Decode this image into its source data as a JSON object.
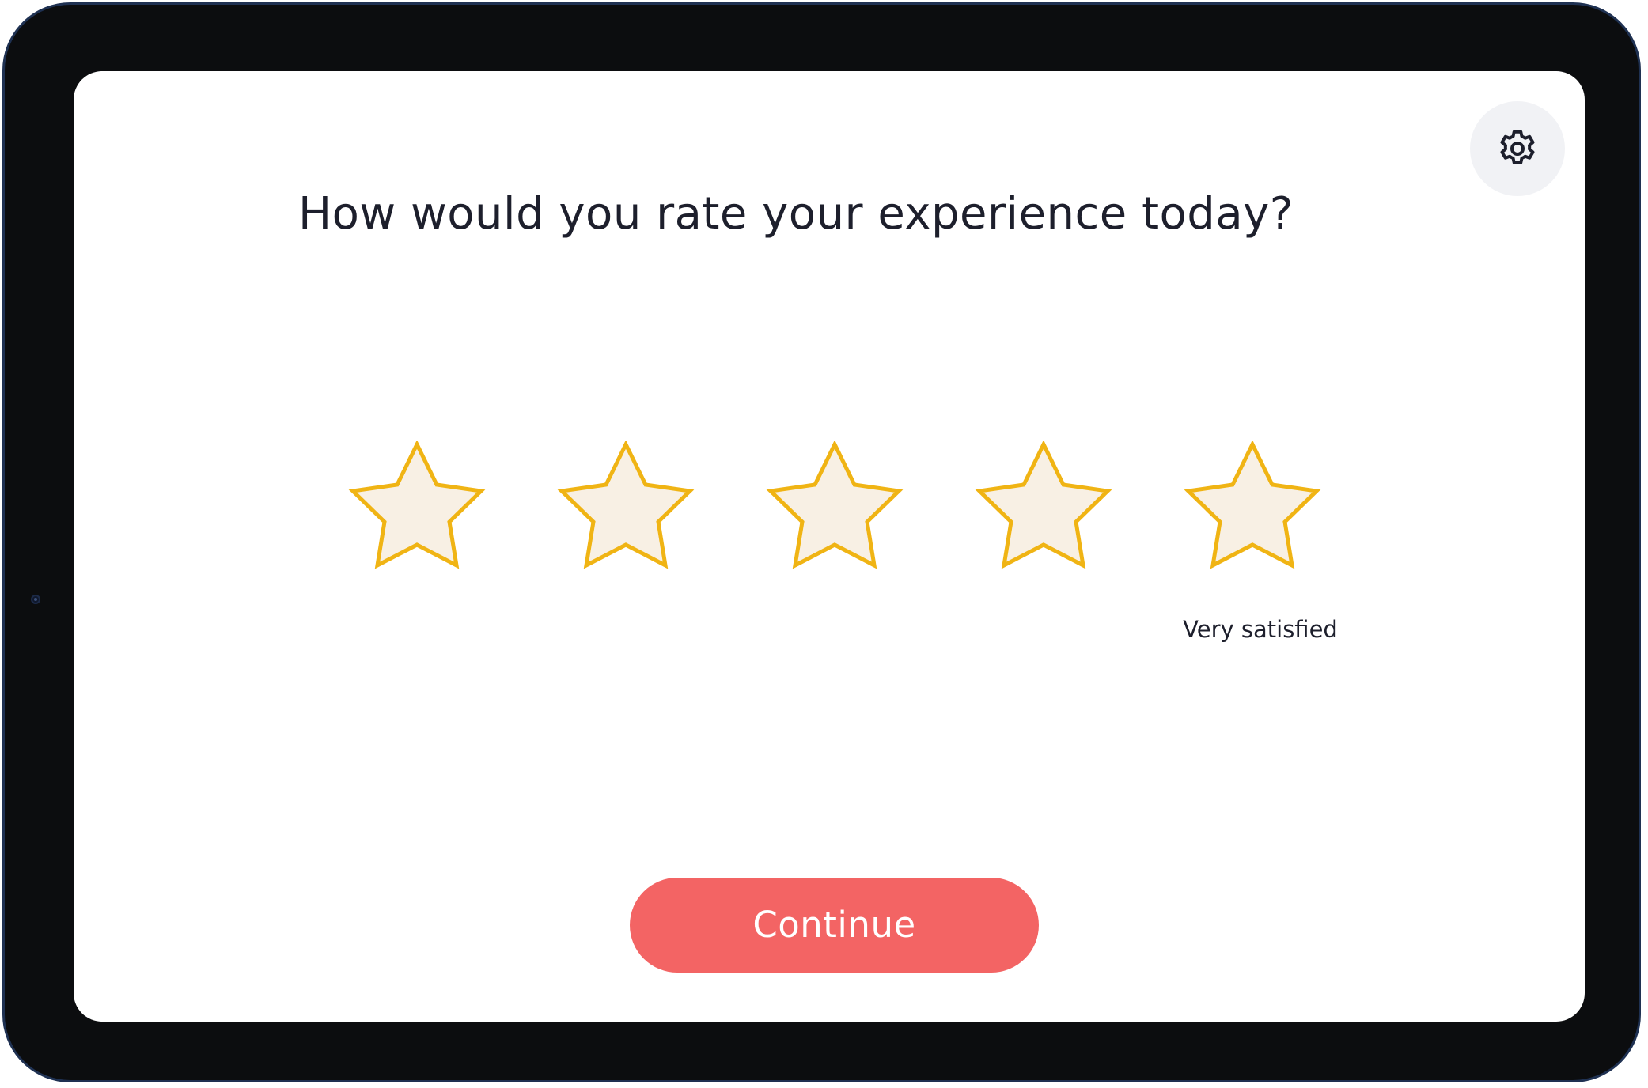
{
  "survey": {
    "question": "How would you rate your experience today?",
    "rating_caption": "Very satisfied",
    "continue_label": "Continue",
    "settings_icon": "gear-icon",
    "stars": [
      {
        "value": 1,
        "icon": "star-outline-icon"
      },
      {
        "value": 2,
        "icon": "star-outline-icon"
      },
      {
        "value": 3,
        "icon": "star-outline-icon"
      },
      {
        "value": 4,
        "icon": "star-outline-icon"
      },
      {
        "value": 5,
        "icon": "star-outline-icon"
      }
    ],
    "selected_rating": 0
  },
  "colors": {
    "star_stroke": "#f0b414",
    "star_fill": "#f8f0e4",
    "continue_button": "#f36464",
    "settings_background": "#f1f2f5",
    "device_frame": "#0c0d0f",
    "device_border": "#1f3152",
    "text": "#1d1f2c"
  }
}
